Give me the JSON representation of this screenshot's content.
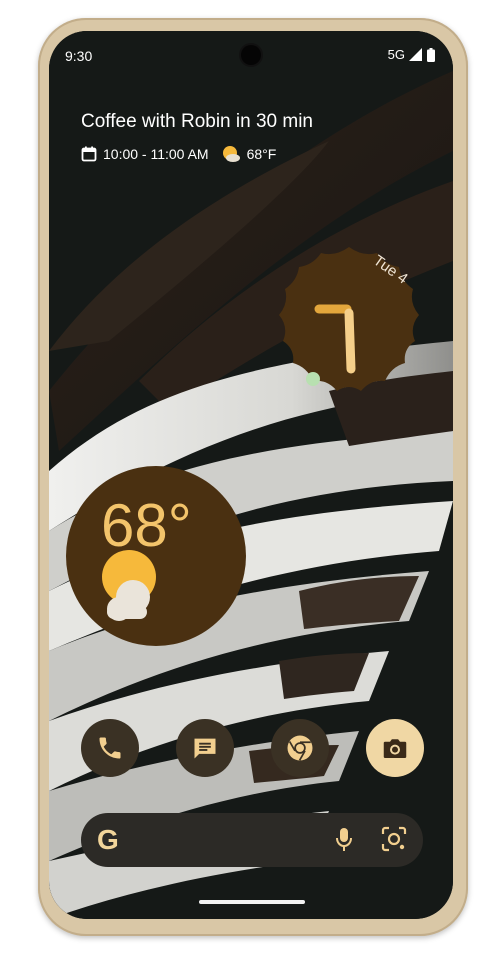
{
  "status_bar": {
    "time": "9:30",
    "network": "5G",
    "icons": [
      "signal-icon",
      "battery-icon"
    ]
  },
  "calendar_event": {
    "title": "Coffee with Robin in 30 min",
    "time_range": "10:00 - 11:00 AM",
    "temperature": "68°F",
    "icons": [
      "calendar-icon",
      "weather-sun-icon"
    ]
  },
  "clock_widget": {
    "date": "Tue 4"
  },
  "weather_widget": {
    "temperature": "68°",
    "icon": "sunny-cloudy-icon"
  },
  "dock": {
    "apps": [
      {
        "name": "Phone",
        "icon": "phone-icon"
      },
      {
        "name": "Messages",
        "icon": "messages-icon"
      },
      {
        "name": "Chrome",
        "icon": "chrome-icon"
      },
      {
        "name": "Camera",
        "icon": "camera-icon"
      }
    ]
  },
  "search_bar": {
    "logo": "G",
    "icons": [
      "mic-icon",
      "lens-icon"
    ]
  },
  "colors": {
    "widget_bg": "#4a3011",
    "accent": "#f3c46b",
    "screen_bg": "#141816",
    "frame": "#d9c7a6"
  }
}
